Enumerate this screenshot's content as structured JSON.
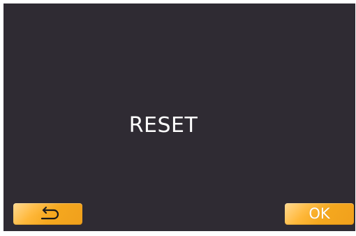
{
  "screen": {
    "title": "RESET",
    "background_color": "#2f2b33"
  },
  "buttons": {
    "back_icon": "return-arrow-icon",
    "ok_label": "OK",
    "accent_color": "#f5a81f"
  }
}
